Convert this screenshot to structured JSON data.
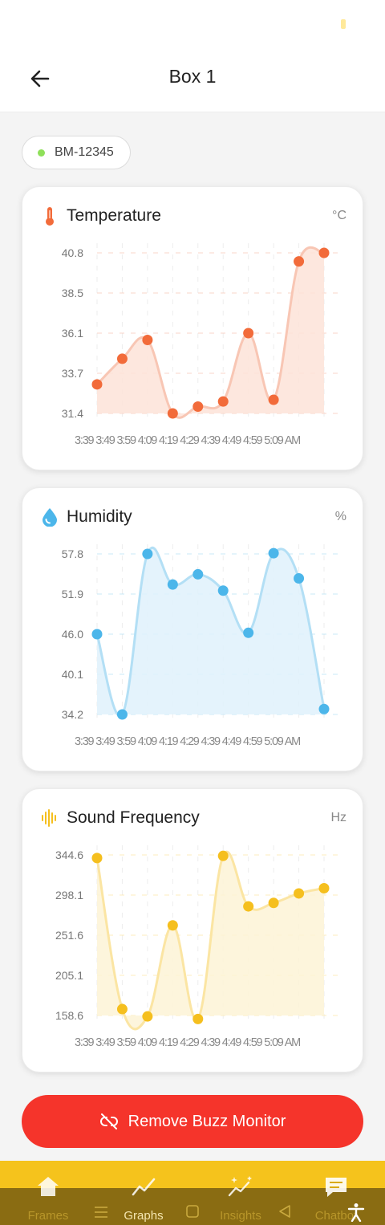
{
  "header": {
    "title": "Box 1"
  },
  "device": {
    "id": "BM-12345",
    "status_color": "#8fe05a"
  },
  "charts": [
    {
      "key": "temperature",
      "title": "Temperature",
      "unit": "°C",
      "color": "#f26b3a",
      "fill": "#fde3d8",
      "line": "#f8c6b4",
      "icon": "thermometer-icon",
      "y_ticks": [
        "40.8",
        "38.5",
        "36.1",
        "33.7",
        "31.4"
      ]
    },
    {
      "key": "humidity",
      "title": "Humidity",
      "unit": "%",
      "color": "#4cb6ea",
      "fill": "#dff1fb",
      "line": "#b3dff5",
      "icon": "water-drop-icon",
      "y_ticks": [
        "57.8",
        "51.9",
        "46.0",
        "40.1",
        "34.2"
      ]
    },
    {
      "key": "sound",
      "title": "Sound Frequency",
      "unit": "Hz",
      "color": "#f5bf1e",
      "fill": "#fdf3d6",
      "line": "#fbe5a3",
      "icon": "sound-wave-icon",
      "y_ticks": [
        "344.6",
        "298.1",
        "251.6",
        "205.1",
        "158.6"
      ]
    }
  ],
  "x_axis_text": "3:39 3:49 3:59 4:09 4:19 4:29 4:39 4:49 4:59 5:09 AM",
  "chart_data": [
    {
      "type": "area",
      "title": "Temperature",
      "unit": "°C",
      "x": [
        "3:39 AM",
        "3:49 AM",
        "3:59 AM",
        "4:09 AM",
        "4:19 AM",
        "4:29 AM",
        "4:39 AM",
        "4:49 AM",
        "4:59 AM",
        "5:09 AM"
      ],
      "values": [
        33.1,
        34.6,
        35.7,
        31.4,
        31.8,
        32.1,
        36.1,
        32.2,
        40.3,
        40.8
      ],
      "ylim": [
        31.4,
        40.8
      ],
      "grid": true
    },
    {
      "type": "area",
      "title": "Humidity",
      "unit": "%",
      "x": [
        "3:39 AM",
        "3:49 AM",
        "3:59 AM",
        "4:09 AM",
        "4:19 AM",
        "4:29 AM",
        "4:39 AM",
        "4:49 AM",
        "4:59 AM",
        "5:09 AM"
      ],
      "values": [
        46.0,
        34.2,
        57.8,
        53.3,
        54.8,
        52.4,
        46.2,
        57.9,
        54.2,
        35.0
      ],
      "ylim": [
        34.2,
        57.8
      ],
      "grid": true
    },
    {
      "type": "area",
      "title": "Sound Frequency",
      "unit": "Hz",
      "x": [
        "3:39 AM",
        "3:49 AM",
        "3:59 AM",
        "4:09 AM",
        "4:19 AM",
        "4:29 AM",
        "4:39 AM",
        "4:49 AM",
        "4:59 AM",
        "5:09 AM"
      ],
      "values": [
        341.0,
        166.0,
        157.5,
        263.0,
        154.5,
        343.5,
        285.0,
        289.0,
        300.0,
        306.0
      ],
      "ylim": [
        158.6,
        344.6
      ],
      "grid": true
    }
  ],
  "actions": {
    "remove_label": "Remove Buzz Monitor"
  },
  "nav": {
    "items": [
      {
        "label": "Frames",
        "icon": "home-icon"
      },
      {
        "label": "Graphs",
        "icon": "line-chart-icon"
      },
      {
        "label": "Insights",
        "icon": "sparkle-chart-icon"
      },
      {
        "label": "Chatbot",
        "icon": "chat-icon"
      }
    ]
  }
}
